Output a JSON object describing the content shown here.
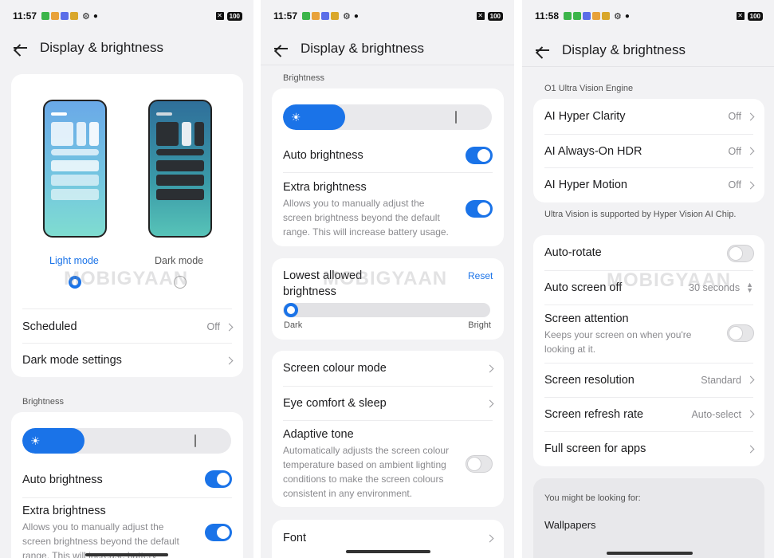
{
  "screen1": {
    "time": "11:57",
    "battery": "100",
    "title": "Display & brightness",
    "light_mode": "Light mode",
    "dark_mode": "Dark mode",
    "scheduled": "Scheduled",
    "scheduled_value": "Off",
    "dark_mode_settings": "Dark mode settings",
    "brightness_label": "Brightness",
    "auto_brightness": "Auto brightness",
    "extra_brightness": "Extra brightness",
    "extra_desc": "Allows you to manually adjust the screen brightness beyond the default range. This will increase battery usage."
  },
  "screen2": {
    "time": "11:57",
    "battery": "100",
    "title": "Display & brightness",
    "brightness_label": "Brightness",
    "auto_brightness": "Auto brightness",
    "extra_brightness": "Extra brightness",
    "extra_desc": "Allows you to manually adjust the screen brightness beyond the default range. This will increase battery usage.",
    "lowest_allowed": "Lowest allowed brightness",
    "reset": "Reset",
    "dark": "Dark",
    "bright": "Bright",
    "screen_colour_mode": "Screen colour mode",
    "eye_comfort": "Eye comfort & sleep",
    "adaptive_tone": "Adaptive tone",
    "adaptive_desc": "Automatically adjusts the screen colour temperature based on ambient lighting conditions to make the screen colours consistent in any environment.",
    "font": "Font"
  },
  "screen3": {
    "time": "11:58",
    "battery": "100",
    "title": "Display & brightness",
    "engine_label": "O1 Ultra Vision Engine",
    "ai_hyper_clarity": "AI Hyper Clarity",
    "ai_hyper_clarity_value": "Off",
    "ai_always_on_hdr": "AI Always-On HDR",
    "ai_always_on_hdr_value": "Off",
    "ai_hyper_motion": "AI Hyper Motion",
    "ai_hyper_motion_value": "Off",
    "ultra_vision_note": "Ultra Vision is supported by Hyper Vision AI Chip.",
    "auto_rotate": "Auto-rotate",
    "auto_screen_off": "Auto screen off",
    "auto_screen_off_value": "30 seconds",
    "screen_attention": "Screen attention",
    "screen_attention_desc": "Keeps your screen on when you're looking at it.",
    "screen_resolution": "Screen resolution",
    "screen_resolution_value": "Standard",
    "screen_refresh_rate": "Screen refresh rate",
    "screen_refresh_rate_value": "Auto-select",
    "full_screen_apps": "Full screen for apps",
    "looking_for": "You might be looking for:",
    "wallpapers": "Wallpapers"
  },
  "watermark": "MOBIGYAAN",
  "colors": {
    "accent": "#1a73e8",
    "background": "#f2f2f4",
    "card": "#ffffff"
  }
}
